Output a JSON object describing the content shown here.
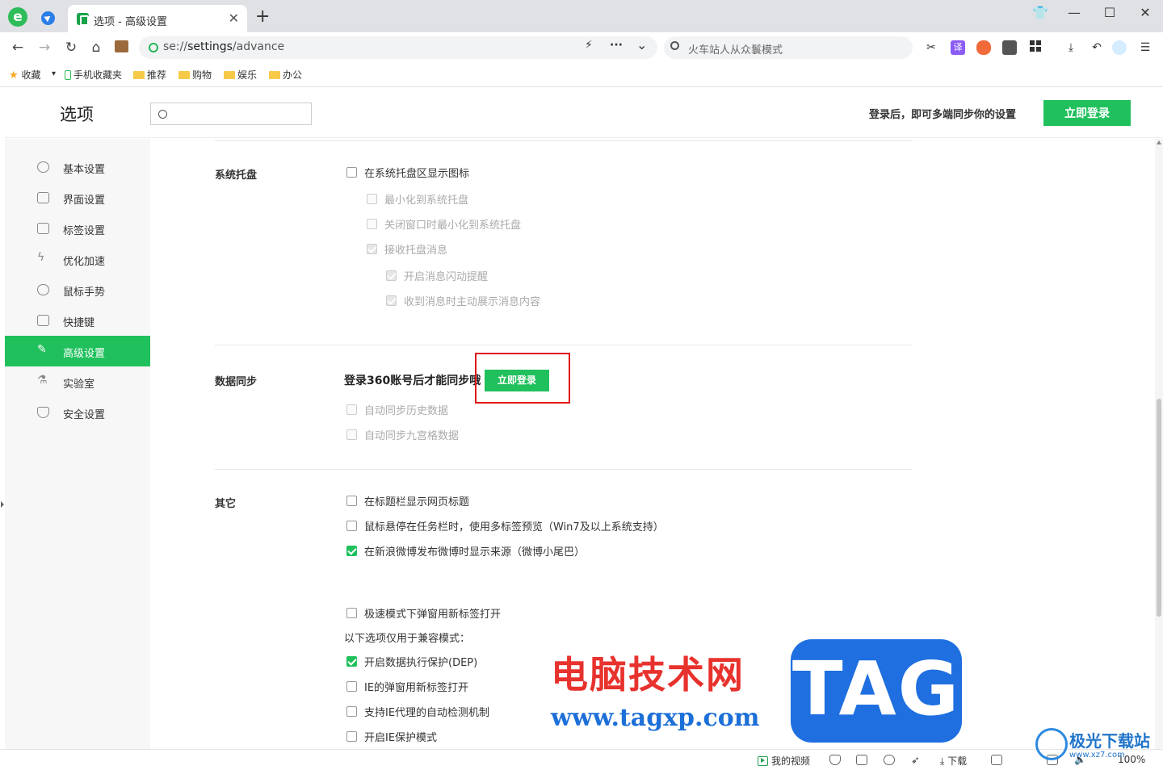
{
  "browser": {
    "logo_letter": "e",
    "tab": {
      "title": "选项 - 高级设置",
      "close": "✕"
    },
    "new_tab": "+",
    "window_controls": {
      "skin": "👕",
      "minimize": "—",
      "maximize": "☐",
      "close": "✕"
    }
  },
  "toolbar": {
    "back": "←",
    "forward": "→",
    "reload": "↻",
    "home": "⌂",
    "url_scheme": "se://",
    "url_host": "settings",
    "url_path": "/advance",
    "flash": "⚡",
    "more": "···",
    "dropdown": "⌄",
    "search_placeholder": "火车站人从众鬟模式",
    "cut": "✂",
    "translate": "译",
    "download": "⤓",
    "undo": "↶",
    "menu": "☰"
  },
  "bookmarks": {
    "favorites": "收藏",
    "favorites_arrow": "▾",
    "mobile": "手机收藏夹",
    "folders": [
      "推荐",
      "购物",
      "娱乐",
      "办公"
    ]
  },
  "settings": {
    "title": "选项",
    "search_placeholder": "",
    "login_tip": "登录后，即可多端同步你的设置",
    "login_button": "立即登录",
    "sidebar": [
      {
        "label": "基本设置",
        "active": false
      },
      {
        "label": "界面设置",
        "active": false
      },
      {
        "label": "标签设置",
        "active": false
      },
      {
        "label": "优化加速",
        "active": false
      },
      {
        "label": "鼠标手势",
        "active": false
      },
      {
        "label": "快捷键",
        "active": false
      },
      {
        "label": "高级设置",
        "active": true
      },
      {
        "label": "实验室",
        "active": false
      },
      {
        "label": "安全设置",
        "active": false
      }
    ],
    "tray": {
      "title": "系统托盘",
      "options": [
        {
          "label": "在系统托盘区显示图标",
          "checked": false,
          "disabled": false
        },
        {
          "label": "最小化到系统托盘",
          "checked": false,
          "disabled": true
        },
        {
          "label": "关闭窗口时最小化到系统托盘",
          "checked": false,
          "disabled": true
        },
        {
          "label": "接收托盘消息",
          "checked": true,
          "disabled": true
        },
        {
          "label": "开启消息闪动提醒",
          "checked": true,
          "disabled": true
        },
        {
          "label": "收到消息时主动展示消息内容",
          "checked": true,
          "disabled": true
        }
      ]
    },
    "sync": {
      "title": "数据同步",
      "tip": "登录360账号后才能同步哦",
      "login_button": "立即登录",
      "options": [
        {
          "label": "自动同步历史数据",
          "checked": false,
          "disabled": true
        },
        {
          "label": "自动同步九宫格数据",
          "checked": false,
          "disabled": true
        }
      ]
    },
    "other": {
      "title": "其它",
      "options": [
        {
          "label": "在标题栏显示网页标题",
          "checked": false
        },
        {
          "label": "鼠标悬停在任务栏时，使用多标签预览（Win7及以上系统支持）",
          "checked": false
        },
        {
          "label": "在新浪微博发布微博时显示来源（微博小尾巴）",
          "checked": true
        },
        {
          "label": "极速模式下弹窗用新标签打开",
          "checked": false
        }
      ],
      "compat_note": "以下选项仅用于兼容模式：",
      "compat_options": [
        {
          "label": "开启数据执行保护(DEP)",
          "checked": true
        },
        {
          "label": "IE的弹窗用新标签打开",
          "checked": false
        },
        {
          "label": "支持IE代理的自动检测机制",
          "checked": false
        },
        {
          "label": "开启IE保护模式",
          "checked": false
        }
      ]
    }
  },
  "watermark": {
    "site_name": "电脑技术网",
    "site_url": "www.tagxp.com",
    "tag": "TAG",
    "logo_name": "极光下载站",
    "logo_url": "www.xz7.com"
  },
  "statusbar": {
    "my_video": "我的视频",
    "download": "下载",
    "zoom": "100%"
  },
  "colors": {
    "accent": "#20c05c",
    "highlight": "#e01818"
  }
}
